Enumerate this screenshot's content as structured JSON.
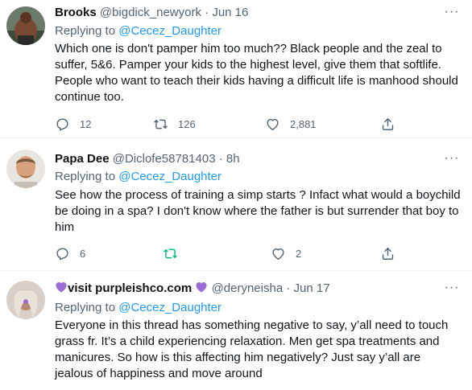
{
  "tweets": [
    {
      "name": "Brooks",
      "handle": "@bigdick_newyork",
      "time": "· Jun 16",
      "replying_prefix": "Replying to",
      "replying_to": "@Cecez_Daughter",
      "text": "Which one is don't pamper him too much?? Black people and the zeal to suffer, 5&6. Pamper your kids to the highest level, give them that softlife. People who want to teach their kids having a difficult life is manhood should continue too.",
      "replies": "12",
      "retweets": "126",
      "likes": "2,881",
      "more": "···"
    },
    {
      "name": "Papa Dee",
      "handle": "@Diclofe58781403",
      "time": "· 8h",
      "replying_prefix": "Replying to",
      "replying_to": "@Cecez_Daughter",
      "text": "See how the process of training a simp starts ? Infact what would a boychild be doing in a spa? I don't know where the father is but surrender that boy to him",
      "replies": "6",
      "retweets": "",
      "likes": "2",
      "more": "···",
      "retweet_color": "#00ba7c"
    },
    {
      "name": "visit purpleishco.com",
      "handle": "@deryneisha",
      "time": "· Jun 17",
      "replying_prefix": "Replying to",
      "replying_to": "@Cecez_Daughter",
      "text": "Everyone in this thread has something negative to say, y’all need to touch grass fr. It’s a child experiencing relaxation. Men get spa treatments and manicures. So how is this affecting him negatively? Just say y’all are jealous of happiness and move around",
      "more": "···",
      "emoji": "purple-heart-emoji"
    }
  ],
  "colors": {
    "link": "#1d9bf0",
    "secondary": "#536471",
    "border": "#eff3f4",
    "purple": "#9b6bd6"
  }
}
